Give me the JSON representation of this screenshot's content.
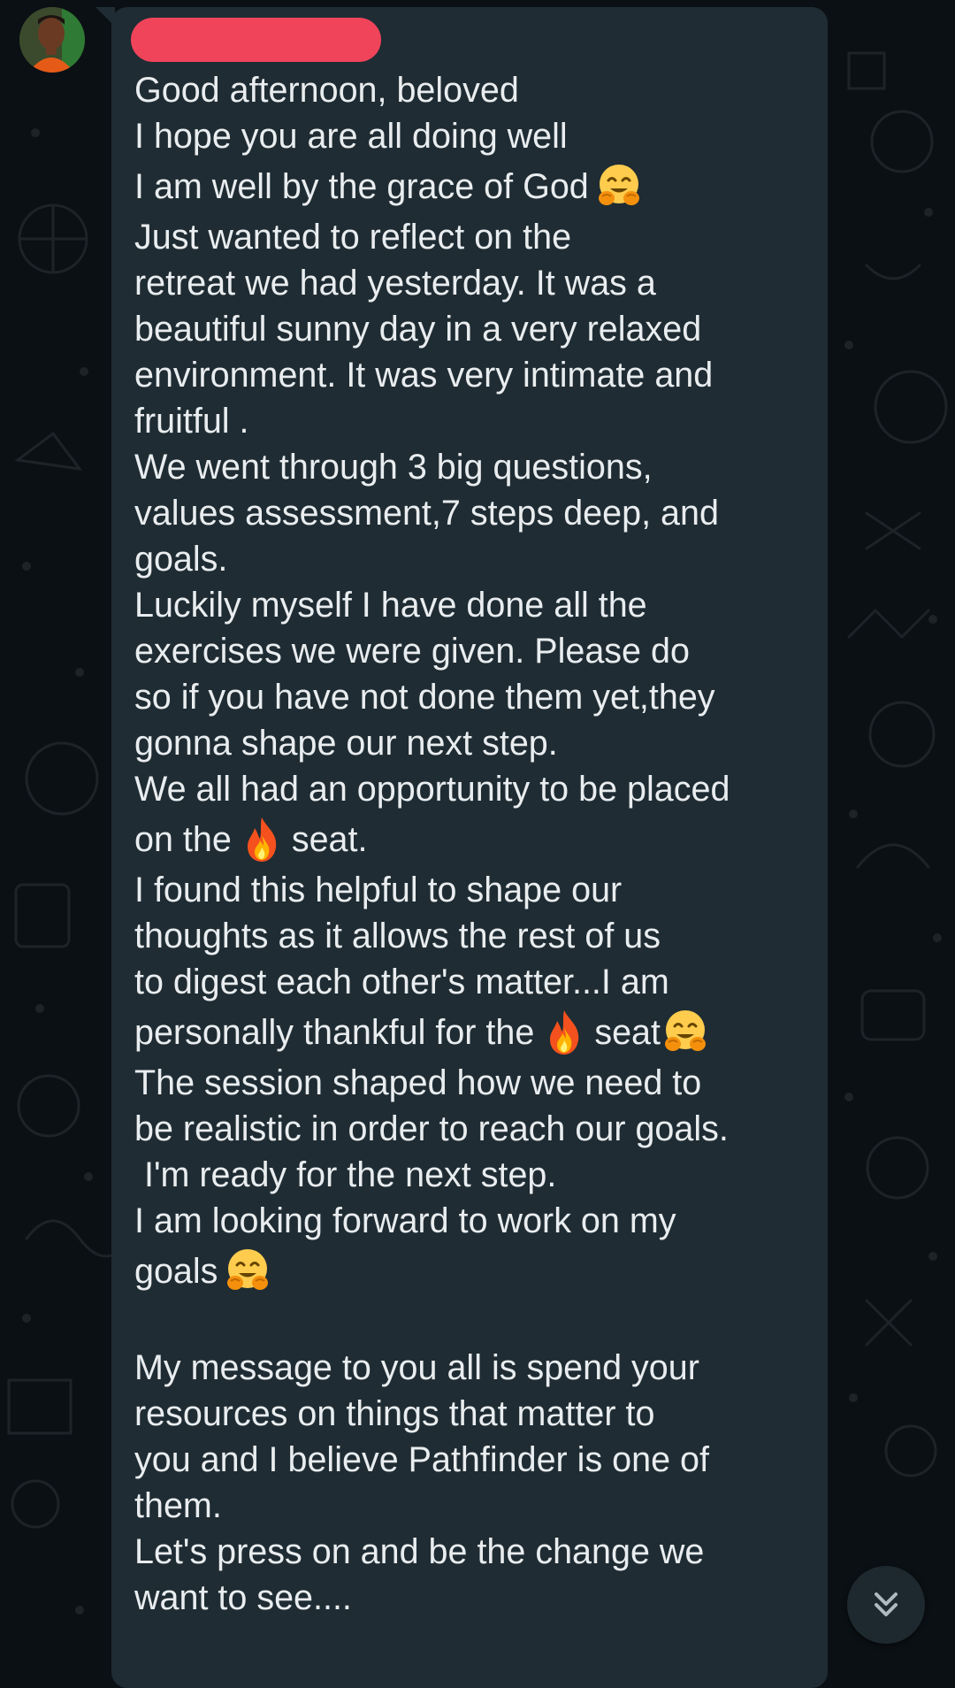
{
  "chat": {
    "sender_name_redacted": true,
    "message_lines": [
      {
        "text": "Good afternoon, beloved"
      },
      {
        "text": "I hope you are all doing well"
      },
      {
        "text": "I am well by the grace of God",
        "emoji_after": "hugging-face"
      },
      {
        "text": "Just wanted to reflect on the"
      },
      {
        "text": "retreat we had yesterday. It was a"
      },
      {
        "text": "beautiful sunny day in a very relaxed"
      },
      {
        "text": "environment. It was very intimate and"
      },
      {
        "text": "fruitful ."
      },
      {
        "text": "We went through 3 big questions,"
      },
      {
        "text": "values assessment,7 steps deep, and"
      },
      {
        "text": "goals."
      },
      {
        "text": "Luckily myself I have done all the"
      },
      {
        "text": "exercises we were given. Please do"
      },
      {
        "text": "so if you have not done them yet,they"
      },
      {
        "text": "gonna shape our next step."
      },
      {
        "text": "We all had an opportunity to be placed"
      },
      {
        "text": "on the",
        "emoji_after": "fire",
        "text_after": "seat."
      },
      {
        "text": "I found this helpful to shape our"
      },
      {
        "text": "thoughts as it allows the rest of us"
      },
      {
        "text": "to digest each other's matter...I am"
      },
      {
        "text": "personally thankful for the",
        "emoji_after": "fire",
        "text_after": "seat",
        "emoji_end": "hugging-face"
      },
      {
        "text": "The session shaped how we need to"
      },
      {
        "text": "be realistic in order to reach our goals."
      },
      {
        "text": " I'm ready for the next step."
      },
      {
        "text": "I am looking forward to work on my"
      },
      {
        "text": "goals",
        "emoji_after": "hugging-face"
      },
      {
        "text": ""
      },
      {
        "text": "My message to you all is spend your"
      },
      {
        "text": "resources on things that matter to"
      },
      {
        "text": "you and I believe Pathfinder is one of"
      },
      {
        "text": "them."
      },
      {
        "text": "Let's press on and be the change we"
      },
      {
        "text": "want to see...."
      }
    ]
  },
  "icons": {
    "scroll_down": "double-chevron-down-icon",
    "hug": "hugging-face-emoji",
    "fire": "fire-emoji"
  },
  "colors": {
    "background": "#0b1014",
    "bubble": "#1f2c33",
    "text": "#e9edef",
    "redaction": "#f0445a"
  }
}
